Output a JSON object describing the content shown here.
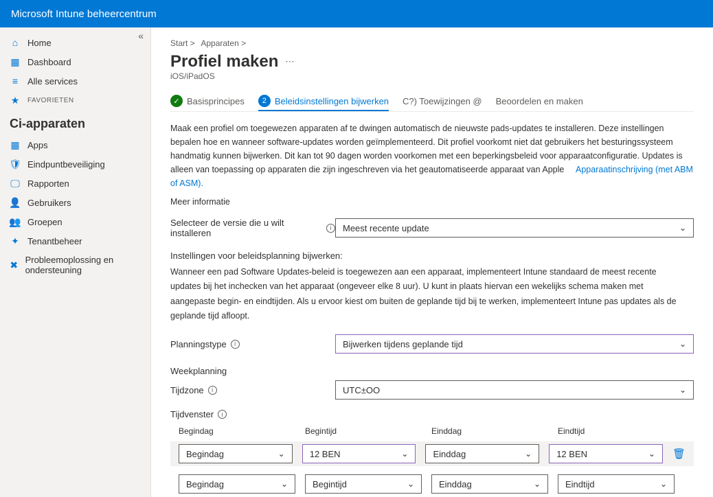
{
  "topbar": {
    "title": "Microsoft Intune beheercentrum"
  },
  "sidebar": {
    "home": "Home",
    "dashboard": "Dashboard",
    "allservices": "Alle services",
    "favorites": "FAVORIETEN",
    "section": "Ci-apparaten",
    "apps": "Apps",
    "endpoint": "Eindpuntbeveiliging",
    "reports": "Rapporten",
    "users": "Gebruikers",
    "groups": "Groepen",
    "tenant": "Tenantbeheer",
    "trouble": "Probleemoplossing en ondersteuning"
  },
  "breadcrumb": {
    "b1": "Start >",
    "b2": "Apparaten >"
  },
  "page": {
    "title": "Profiel maken",
    "subtitle": "iOS/iPadOS"
  },
  "stepper": {
    "s1": "Basisprincipes",
    "s2num": "2",
    "s2": "Beleidsinstellingen bijwerken",
    "s3": "C?) Toewijzingen @",
    "s4": "Beoordelen en maken"
  },
  "desc": {
    "p1a": "Maak een profiel om toegewezen apparaten af te dwingen automatisch de nieuwste pads-updates te installeren. Deze instellingen bepalen hoe en wanneer software-updates worden geïmplementeerd. Dit profiel voorkomt niet dat gebruikers het besturingssysteem handmatig kunnen bijwerken. Dit kan tot 90 dagen worden voorkomen met een beperkingsbeleid voor apparaatconfiguratie. Updates is alleen van toepassing op apparaten die zijn ingeschreven via het geautomatiseerde apparaat van Apple",
    "p1link": "Apparaatinschrijving (met ABM of ASM).",
    "more": "Meer informatie"
  },
  "form": {
    "versionLabel": "Selecteer de versie die u wilt installeren",
    "versionValue": "Meest recente update",
    "scheduleHeading": "Instellingen voor beleidsplanning bijwerken:",
    "scheduleDesc": "Wanneer een pad Software Updates-beleid is toegewezen aan een apparaat, implementeert Intune standaard de meest recente updates bij het inchecken van het apparaat (ongeveer elke 8 uur). U kunt in plaats hiervan een wekelijks schema maken met aangepaste begin- en eindtijden. Als u ervoor kiest om buiten de geplande tijd bij te werken, implementeert Intune pas updates als de geplande tijd afloopt.",
    "planTypeLabel": "Planningstype",
    "planTypeValue": "Bijwerken tijdens geplande tijd",
    "weekLabel": "Weekplanning",
    "tzLabel": "Tijdzone",
    "tzValue": "UTC±OO",
    "windowLabel": "Tijdvenster"
  },
  "cols": {
    "c1": "Begindag",
    "c2": "Begintijd",
    "c3": "Einddag",
    "c4": "Eindtijd"
  },
  "row1": {
    "v1": "Begindag",
    "v2": "12 BEN",
    "v3": "Einddag",
    "v4": "12 BEN"
  },
  "row2": {
    "v1": "Begindag",
    "v2": "Begintijd",
    "v3": "Einddag",
    "v4": "Eindtijd"
  }
}
